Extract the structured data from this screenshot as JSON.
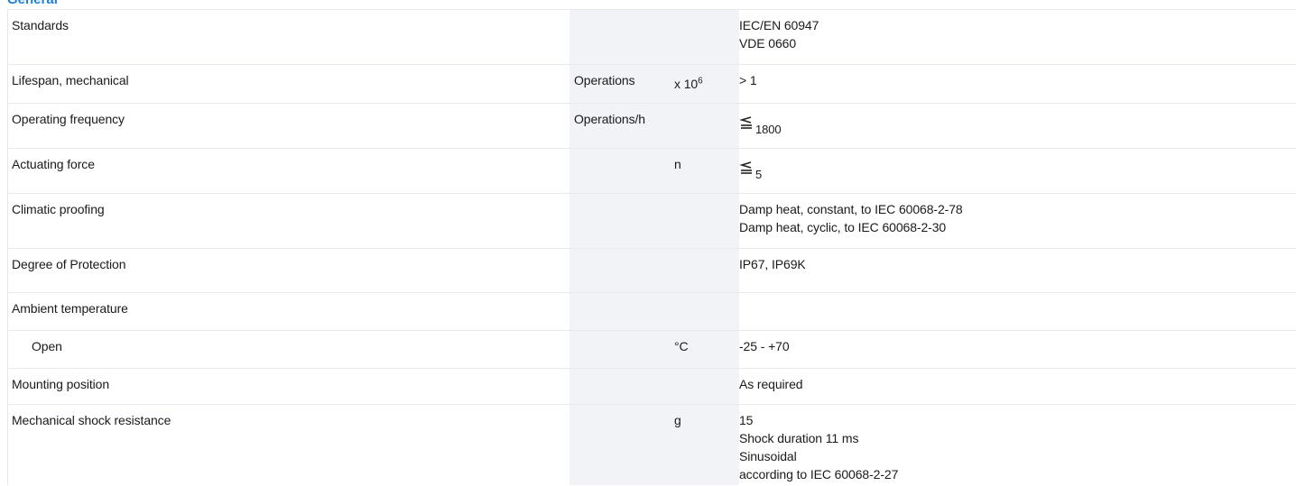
{
  "section": {
    "title": "General"
  },
  "rows": [
    {
      "label": "Standards",
      "unit": "",
      "multiplier": "",
      "value_lines": [
        "IEC/EN 60947",
        "VDE 0660"
      ]
    },
    {
      "label": "Lifespan, mechanical",
      "unit": "Operations",
      "multiplier": "x 10",
      "multiplier_exp": "6",
      "value_lines": [
        "> 1"
      ]
    },
    {
      "label": "Operating frequency",
      "unit": "Operations/h",
      "multiplier": "",
      "value_icon": "less-or-equal-icon",
      "value_lines": [
        "1800"
      ]
    },
    {
      "label": "Actuating force",
      "unit": "",
      "multiplier": "n",
      "value_icon": "less-or-equal-icon",
      "value_lines": [
        "5"
      ]
    },
    {
      "label": "Climatic proofing",
      "unit": "",
      "multiplier": "",
      "value_lines": [
        "Damp heat, constant, to IEC 60068-2-78",
        "Damp heat, cyclic, to IEC 60068-2-30"
      ]
    },
    {
      "label": "Degree of Protection",
      "unit": "",
      "multiplier": "",
      "value_lines": [
        "IP67, IP69K"
      ]
    },
    {
      "label": "Ambient temperature",
      "unit": "",
      "multiplier": "",
      "value_lines": []
    },
    {
      "label": "Open",
      "unit": "",
      "multiplier": "°C",
      "value_lines": [
        "-25 - +70"
      ]
    },
    {
      "label": "Mounting position",
      "unit": "",
      "multiplier": "",
      "value_lines": [
        "As required"
      ]
    },
    {
      "label": "Mechanical shock resistance",
      "unit": "",
      "multiplier": "g",
      "value_lines": [
        "15",
        "Shock duration 11 ms",
        "Sinusoidal",
        "according to IEC 60068-2-27"
      ]
    }
  ],
  "colors": {
    "section_title": "#1f7fd6",
    "shaded_column": "#f1f3f7",
    "row_border": "#e7e9ee"
  }
}
